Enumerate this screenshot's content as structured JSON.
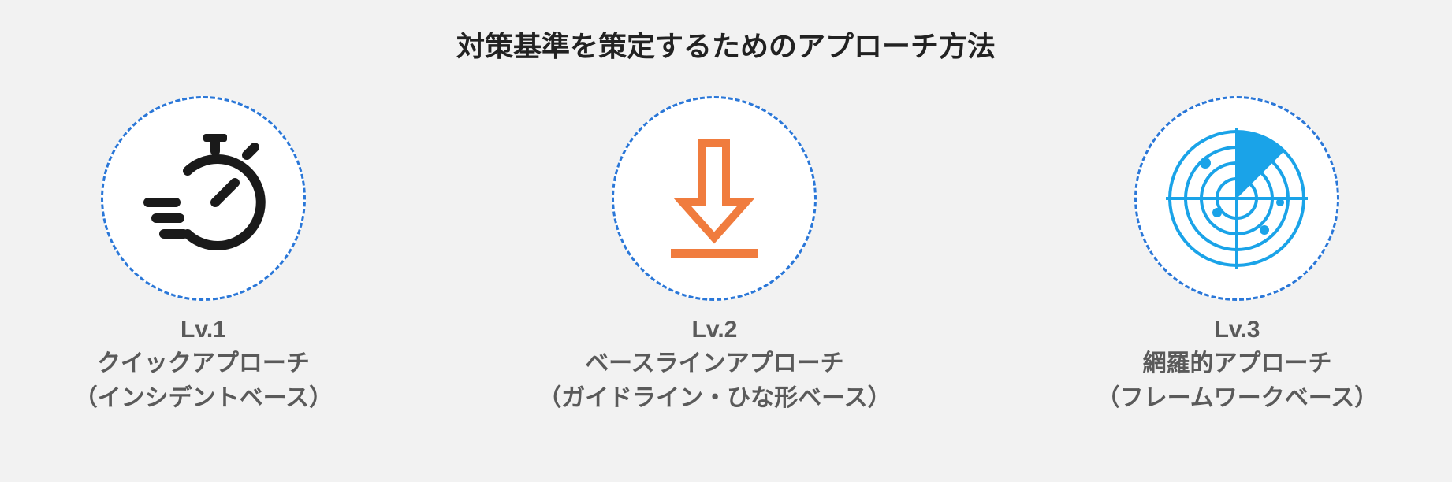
{
  "title": "対策基準を策定するためのアプローチ方法",
  "approaches": [
    {
      "level": "Lv.1",
      "name": "クイックアプローチ",
      "base": "（インシデントベース）",
      "icon": "stopwatch-speed-icon"
    },
    {
      "level": "Lv.2",
      "name": "ベースラインアプローチ",
      "base": "（ガイドライン・ひな形ベース）",
      "icon": "download-arrow-icon"
    },
    {
      "level": "Lv.3",
      "name": "網羅的アプローチ",
      "base": "（フレームワークベース）",
      "icon": "radar-icon"
    }
  ]
}
